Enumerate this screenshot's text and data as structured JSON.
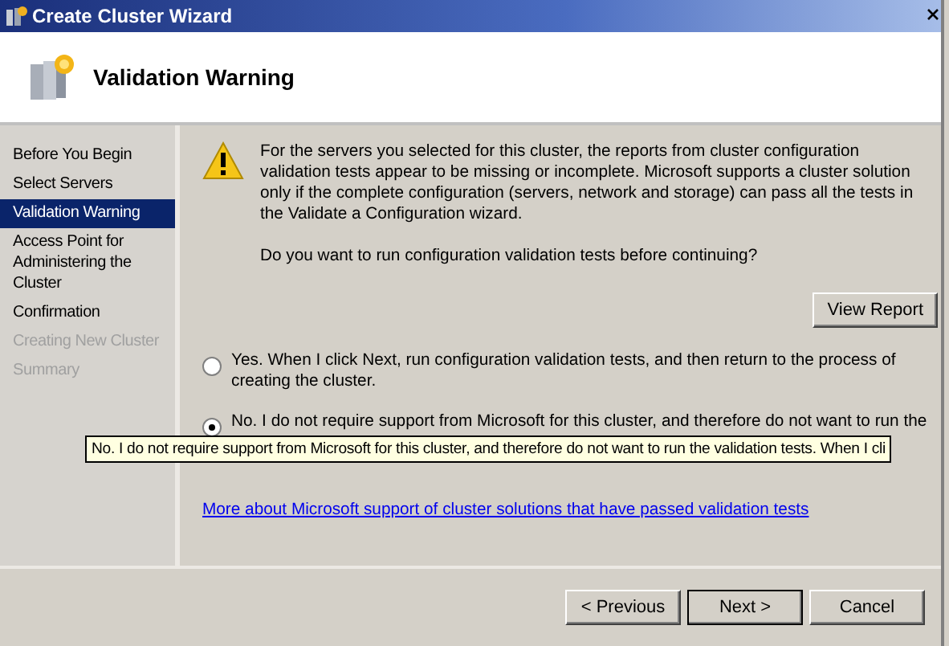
{
  "window": {
    "title": "Create Cluster Wizard"
  },
  "header": {
    "title": "Validation Warning"
  },
  "steps": [
    {
      "label": "Before You Begin",
      "selected": false,
      "disabled": false
    },
    {
      "label": "Select Servers",
      "selected": false,
      "disabled": false
    },
    {
      "label": "Validation Warning",
      "selected": true,
      "disabled": false
    },
    {
      "label": "Access Point for Administering the Cluster",
      "selected": false,
      "disabled": false
    },
    {
      "label": "Confirmation",
      "selected": false,
      "disabled": false
    },
    {
      "label": "Creating New Cluster",
      "selected": false,
      "disabled": true
    },
    {
      "label": "Summary",
      "selected": false,
      "disabled": true
    }
  ],
  "warning": {
    "message": "For the servers you selected for this cluster, the reports from cluster configuration validation tests appear to be missing or incomplete.  Microsoft supports a cluster solution only if the complete configuration (servers, network and storage) can pass all the tests in the Validate a Configuration wizard.",
    "question": "Do you want to run configuration validation tests before continuing?"
  },
  "view_report_button": "View Report",
  "options": [
    {
      "label": "Yes.  When I click Next, run configuration validation tests, and then return to the process of creating the cluster.",
      "selected": false
    },
    {
      "label": "No.  I do not require support from Microsoft for this cluster, and therefore do not want to run the",
      "selected": true
    }
  ],
  "tooltip": "No.  I do not require support from Microsoft for this cluster, and therefore do not want to run the validation tests.  When I cli",
  "link": "More about Microsoft support of cluster solutions that have passed validation tests",
  "buttons": [
    "< Previous",
    "Next >",
    "Cancel"
  ]
}
